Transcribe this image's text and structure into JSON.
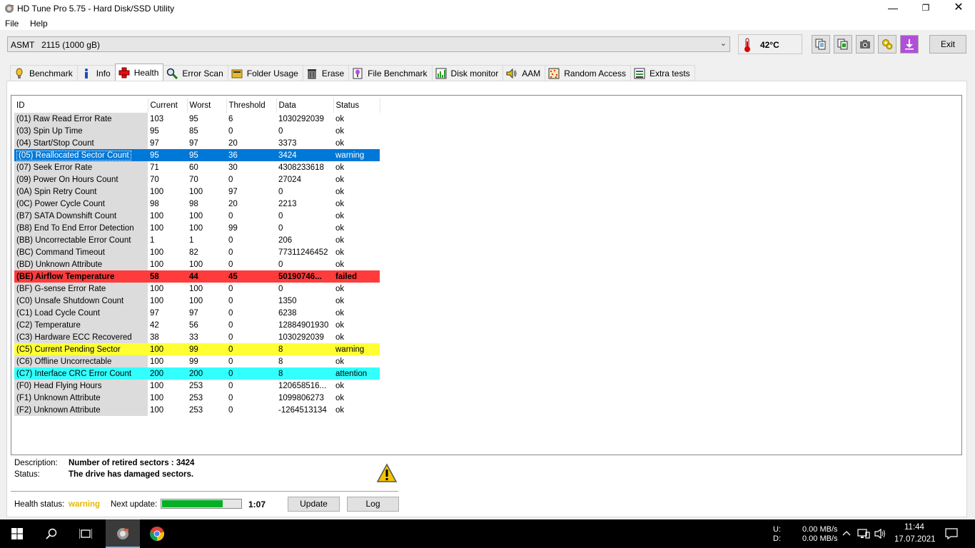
{
  "window": {
    "title": "HD Tune Pro 5.75 - Hard Disk/SSD Utility",
    "minimize": "—",
    "maximize": "❐",
    "close": "✕"
  },
  "menu": {
    "file": "File",
    "help": "Help"
  },
  "toolbar": {
    "drive": "ASMT   2115 (1000 gB)",
    "temperature": "42°C",
    "exit_label": "Exit",
    "icons": [
      "copy-text-icon",
      "copy-screenshot-icon",
      "camera-icon",
      "options-icon",
      "save-icon"
    ]
  },
  "tabs": [
    {
      "label": "Benchmark",
      "icon": "benchmark-icon"
    },
    {
      "label": "Info",
      "icon": "info-icon"
    },
    {
      "label": "Health",
      "icon": "health-icon",
      "active": true
    },
    {
      "label": "Error Scan",
      "icon": "error-scan-icon"
    },
    {
      "label": "Folder Usage",
      "icon": "folder-icon"
    },
    {
      "label": "Erase",
      "icon": "erase-icon"
    },
    {
      "label": "File Benchmark",
      "icon": "file-benchmark-icon"
    },
    {
      "label": "Disk monitor",
      "icon": "disk-monitor-icon"
    },
    {
      "label": "AAM",
      "icon": "speaker-icon"
    },
    {
      "label": "Random Access",
      "icon": "random-access-icon"
    },
    {
      "label": "Extra tests",
      "icon": "extra-tests-icon"
    }
  ],
  "smart": {
    "columns": [
      "ID",
      "Current",
      "Worst",
      "Threshold",
      "Data",
      "Status"
    ],
    "rows": [
      [
        "(01) Raw Read Error Rate",
        "103",
        "95",
        "6",
        "1030292039",
        "ok",
        ""
      ],
      [
        "(03) Spin Up Time",
        "95",
        "85",
        "0",
        "0",
        "ok",
        ""
      ],
      [
        "(04) Start/Stop Count",
        "97",
        "97",
        "20",
        "3373",
        "ok",
        ""
      ],
      [
        "(05) Reallocated Sector Count",
        "95",
        "95",
        "36",
        "3424",
        "warning",
        "sel"
      ],
      [
        "(07) Seek Error Rate",
        "71",
        "60",
        "30",
        "4308233618",
        "ok",
        ""
      ],
      [
        "(09) Power On Hours Count",
        "70",
        "70",
        "0",
        "27024",
        "ok",
        ""
      ],
      [
        "(0A) Spin Retry Count",
        "100",
        "100",
        "97",
        "0",
        "ok",
        ""
      ],
      [
        "(0C) Power Cycle Count",
        "98",
        "98",
        "20",
        "2213",
        "ok",
        ""
      ],
      [
        "(B7) SATA Downshift Count",
        "100",
        "100",
        "0",
        "0",
        "ok",
        ""
      ],
      [
        "(B8) End To End Error Detection",
        "100",
        "100",
        "99",
        "0",
        "ok",
        ""
      ],
      [
        "(BB) Uncorrectable Error Count",
        "1",
        "1",
        "0",
        "206",
        "ok",
        ""
      ],
      [
        "(BC) Command Timeout",
        "100",
        "82",
        "0",
        "77311246452",
        "ok",
        ""
      ],
      [
        "(BD) Unknown Attribute",
        "100",
        "100",
        "0",
        "0",
        "ok",
        ""
      ],
      [
        "(BE) Airflow Temperature",
        "58",
        "44",
        "45",
        "50190746...",
        "failed",
        "failed"
      ],
      [
        "(BF) G-sense Error Rate",
        "100",
        "100",
        "0",
        "0",
        "ok",
        ""
      ],
      [
        "(C0) Unsafe Shutdown Count",
        "100",
        "100",
        "0",
        "1350",
        "ok",
        ""
      ],
      [
        "(C1) Load Cycle Count",
        "97",
        "97",
        "0",
        "6238",
        "ok",
        ""
      ],
      [
        "(C2) Temperature",
        "42",
        "56",
        "0",
        "12884901930",
        "ok",
        ""
      ],
      [
        "(C3) Hardware ECC Recovered",
        "38",
        "33",
        "0",
        "1030292039",
        "ok",
        ""
      ],
      [
        "(C5) Current Pending Sector",
        "100",
        "99",
        "0",
        "8",
        "warning",
        "warn"
      ],
      [
        "(C6) Offline Uncorrectable",
        "100",
        "99",
        "0",
        "8",
        "ok",
        ""
      ],
      [
        "(C7) Interface CRC Error Count",
        "200",
        "200",
        "0",
        "8",
        "attention",
        "attn"
      ],
      [
        "(F0) Head Flying Hours",
        "100",
        "253",
        "0",
        "120658516...",
        "ok",
        ""
      ],
      [
        "(F1) Unknown Attribute",
        "100",
        "253",
        "0",
        "1099806273",
        "ok",
        ""
      ],
      [
        "(F2) Unknown Attribute",
        "100",
        "253",
        "0",
        "-1264513134",
        "ok",
        ""
      ]
    ]
  },
  "details": {
    "description_label": "Description:",
    "description_value": "Number of retired sectors : 3424",
    "status_label": "Status:",
    "status_value": "The drive has damaged sectors."
  },
  "footer": {
    "health_label": "Health status:",
    "health_value": "warning",
    "next_update_label": "Next update:",
    "progress_fraction": 0.77,
    "next_update_time": "1:07",
    "update_label": "Update",
    "log_label": "Log"
  },
  "taskbar": {
    "net_u_label": "U:",
    "net_d_label": "D:",
    "net_u_value": "0.00 MB/s",
    "net_d_value": "0.00 MB/s",
    "time": "11:44",
    "date": "17.07.2021"
  }
}
